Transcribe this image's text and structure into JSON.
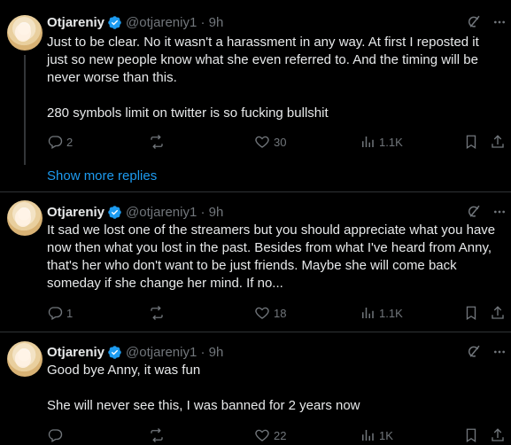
{
  "tweets": [
    {
      "name": "Otjareniy",
      "handle": "@otjareniy1 · 9h",
      "paragraphs": [
        "Just to be clear. No it wasn't a harassment in any way. At first I reposted it just so new people know what she even referred to. And the timing will be never worse than this.",
        "280 symbols limit on twitter is so fucking bullshit"
      ],
      "replies": "2",
      "reposts": "",
      "likes": "30",
      "views": "1.1K"
    },
    {
      "name": "Otjareniy",
      "handle": "@otjareniy1 · 9h",
      "paragraphs": [
        "It sad we lost one of the streamers but you should appreciate what you have now then what you lost in the past. Besides from what I've heard from Anny, that's her who don't want to be just friends. Maybe she will come back someday if she change her mind. If no..."
      ],
      "replies": "1",
      "reposts": "",
      "likes": "18",
      "views": "1.1K"
    },
    {
      "name": "Otjareniy",
      "handle": "@otjareniy1 · 9h",
      "paragraphs": [
        "Good bye Anny, it was fun",
        "She will never see this, I was banned for 2 years now"
      ],
      "replies": "",
      "reposts": "",
      "likes": "22",
      "views": "1K"
    }
  ],
  "show_more_label": "Show more replies",
  "colors": {
    "background": "#000000",
    "text": "#e7e9ea",
    "muted": "#71767b",
    "accent": "#1d9bf0",
    "divider": "#2f3336"
  },
  "icons": [
    "verified-badge-icon",
    "grok-icon",
    "more-icon",
    "reply-icon",
    "repost-icon",
    "like-icon",
    "views-icon",
    "bookmark-icon",
    "share-icon"
  ]
}
